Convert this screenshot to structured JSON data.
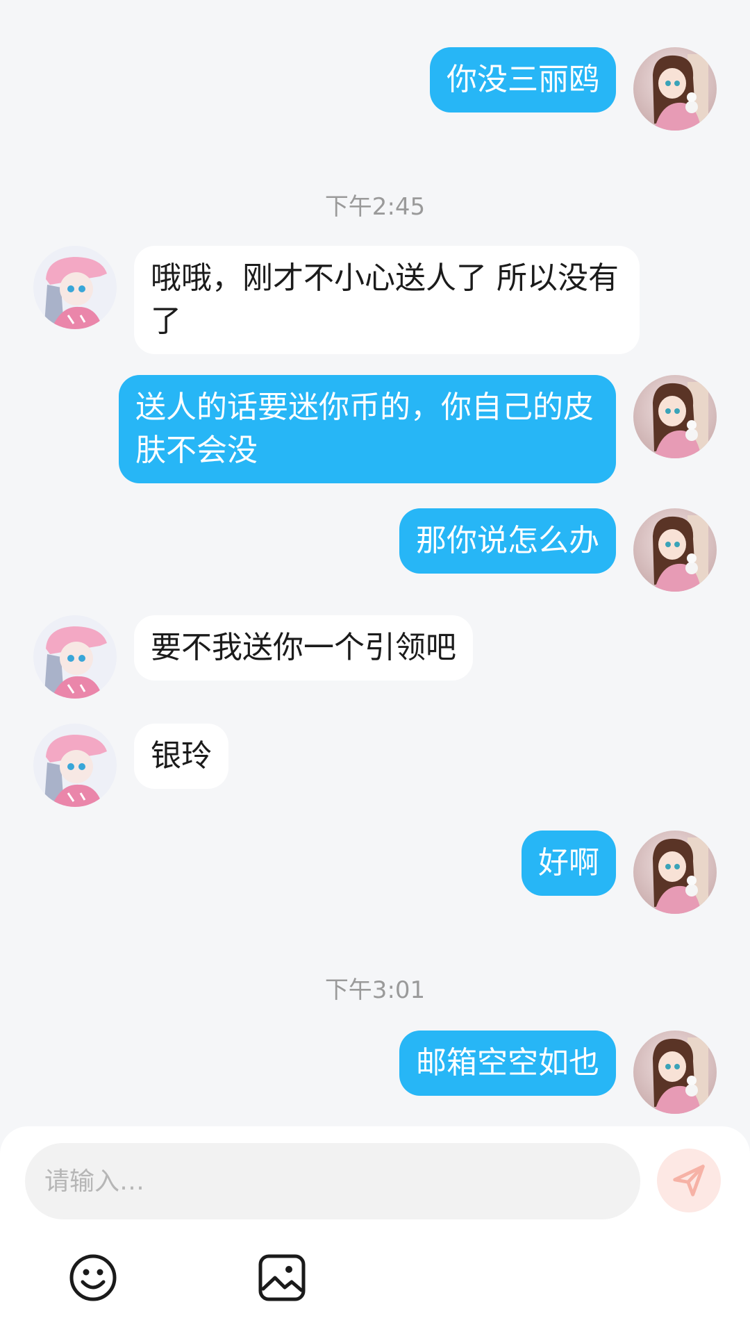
{
  "conversation": {
    "messages": [
      {
        "side": "me",
        "text": "你没三丽鸥"
      },
      {
        "side": "time",
        "text": "下午2:45"
      },
      {
        "side": "other",
        "text": "哦哦，刚才不小心送人了 所以没有了"
      },
      {
        "side": "me",
        "text": "送人的话要迷你币的，你自己的皮肤不会没"
      },
      {
        "side": "me",
        "text": "那你说怎么办"
      },
      {
        "side": "other",
        "text": "要不我送你一个引领吧"
      },
      {
        "side": "other",
        "text": "银玲"
      },
      {
        "side": "me",
        "text": "好啊"
      },
      {
        "side": "time",
        "text": "下午3:01"
      },
      {
        "side": "me",
        "text": "邮箱空空如也"
      }
    ]
  },
  "composer": {
    "placeholder": "请输入…",
    "send_icon": "send-icon",
    "tools": [
      "emoji-icon",
      "image-icon"
    ]
  },
  "colors": {
    "bubble_me": "#27b6f6",
    "bubble_other": "#ffffff",
    "background": "#f5f6f8",
    "send_button": "#fde8e4",
    "send_icon": "#f6b2a6"
  }
}
